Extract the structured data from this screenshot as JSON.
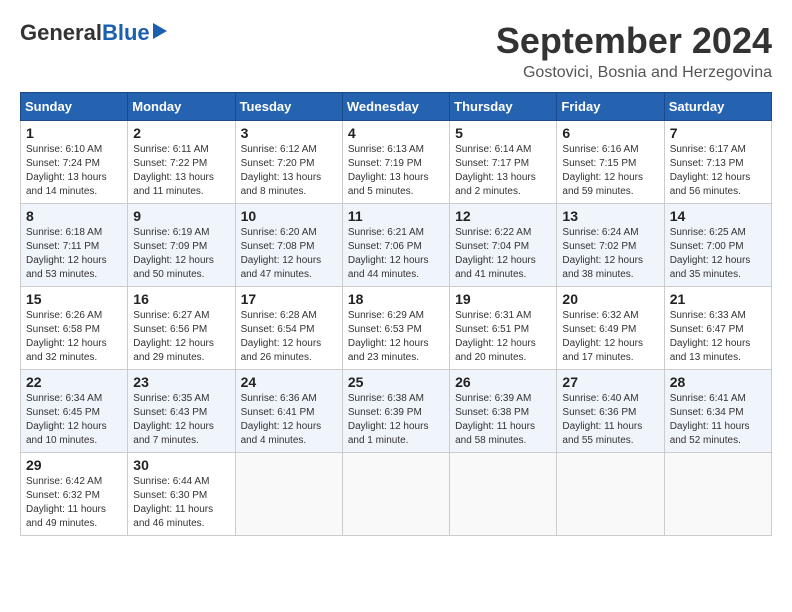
{
  "logo": {
    "general": "General",
    "blue": "Blue"
  },
  "title": "September 2024",
  "location": "Gostovici, Bosnia and Herzegovina",
  "days_of_week": [
    "Sunday",
    "Monday",
    "Tuesday",
    "Wednesday",
    "Thursday",
    "Friday",
    "Saturday"
  ],
  "weeks": [
    [
      {
        "day": "1",
        "info": "Sunrise: 6:10 AM\nSunset: 7:24 PM\nDaylight: 13 hours and 14 minutes."
      },
      {
        "day": "2",
        "info": "Sunrise: 6:11 AM\nSunset: 7:22 PM\nDaylight: 13 hours and 11 minutes."
      },
      {
        "day": "3",
        "info": "Sunrise: 6:12 AM\nSunset: 7:20 PM\nDaylight: 13 hours and 8 minutes."
      },
      {
        "day": "4",
        "info": "Sunrise: 6:13 AM\nSunset: 7:19 PM\nDaylight: 13 hours and 5 minutes."
      },
      {
        "day": "5",
        "info": "Sunrise: 6:14 AM\nSunset: 7:17 PM\nDaylight: 13 hours and 2 minutes."
      },
      {
        "day": "6",
        "info": "Sunrise: 6:16 AM\nSunset: 7:15 PM\nDaylight: 12 hours and 59 minutes."
      },
      {
        "day": "7",
        "info": "Sunrise: 6:17 AM\nSunset: 7:13 PM\nDaylight: 12 hours and 56 minutes."
      }
    ],
    [
      {
        "day": "8",
        "info": "Sunrise: 6:18 AM\nSunset: 7:11 PM\nDaylight: 12 hours and 53 minutes."
      },
      {
        "day": "9",
        "info": "Sunrise: 6:19 AM\nSunset: 7:09 PM\nDaylight: 12 hours and 50 minutes."
      },
      {
        "day": "10",
        "info": "Sunrise: 6:20 AM\nSunset: 7:08 PM\nDaylight: 12 hours and 47 minutes."
      },
      {
        "day": "11",
        "info": "Sunrise: 6:21 AM\nSunset: 7:06 PM\nDaylight: 12 hours and 44 minutes."
      },
      {
        "day": "12",
        "info": "Sunrise: 6:22 AM\nSunset: 7:04 PM\nDaylight: 12 hours and 41 minutes."
      },
      {
        "day": "13",
        "info": "Sunrise: 6:24 AM\nSunset: 7:02 PM\nDaylight: 12 hours and 38 minutes."
      },
      {
        "day": "14",
        "info": "Sunrise: 6:25 AM\nSunset: 7:00 PM\nDaylight: 12 hours and 35 minutes."
      }
    ],
    [
      {
        "day": "15",
        "info": "Sunrise: 6:26 AM\nSunset: 6:58 PM\nDaylight: 12 hours and 32 minutes."
      },
      {
        "day": "16",
        "info": "Sunrise: 6:27 AM\nSunset: 6:56 PM\nDaylight: 12 hours and 29 minutes."
      },
      {
        "day": "17",
        "info": "Sunrise: 6:28 AM\nSunset: 6:54 PM\nDaylight: 12 hours and 26 minutes."
      },
      {
        "day": "18",
        "info": "Sunrise: 6:29 AM\nSunset: 6:53 PM\nDaylight: 12 hours and 23 minutes."
      },
      {
        "day": "19",
        "info": "Sunrise: 6:31 AM\nSunset: 6:51 PM\nDaylight: 12 hours and 20 minutes."
      },
      {
        "day": "20",
        "info": "Sunrise: 6:32 AM\nSunset: 6:49 PM\nDaylight: 12 hours and 17 minutes."
      },
      {
        "day": "21",
        "info": "Sunrise: 6:33 AM\nSunset: 6:47 PM\nDaylight: 12 hours and 13 minutes."
      }
    ],
    [
      {
        "day": "22",
        "info": "Sunrise: 6:34 AM\nSunset: 6:45 PM\nDaylight: 12 hours and 10 minutes."
      },
      {
        "day": "23",
        "info": "Sunrise: 6:35 AM\nSunset: 6:43 PM\nDaylight: 12 hours and 7 minutes."
      },
      {
        "day": "24",
        "info": "Sunrise: 6:36 AM\nSunset: 6:41 PM\nDaylight: 12 hours and 4 minutes."
      },
      {
        "day": "25",
        "info": "Sunrise: 6:38 AM\nSunset: 6:39 PM\nDaylight: 12 hours and 1 minute."
      },
      {
        "day": "26",
        "info": "Sunrise: 6:39 AM\nSunset: 6:38 PM\nDaylight: 11 hours and 58 minutes."
      },
      {
        "day": "27",
        "info": "Sunrise: 6:40 AM\nSunset: 6:36 PM\nDaylight: 11 hours and 55 minutes."
      },
      {
        "day": "28",
        "info": "Sunrise: 6:41 AM\nSunset: 6:34 PM\nDaylight: 11 hours and 52 minutes."
      }
    ],
    [
      {
        "day": "29",
        "info": "Sunrise: 6:42 AM\nSunset: 6:32 PM\nDaylight: 11 hours and 49 minutes."
      },
      {
        "day": "30",
        "info": "Sunrise: 6:44 AM\nSunset: 6:30 PM\nDaylight: 11 hours and 46 minutes."
      },
      {
        "day": "",
        "info": ""
      },
      {
        "day": "",
        "info": ""
      },
      {
        "day": "",
        "info": ""
      },
      {
        "day": "",
        "info": ""
      },
      {
        "day": "",
        "info": ""
      }
    ]
  ]
}
